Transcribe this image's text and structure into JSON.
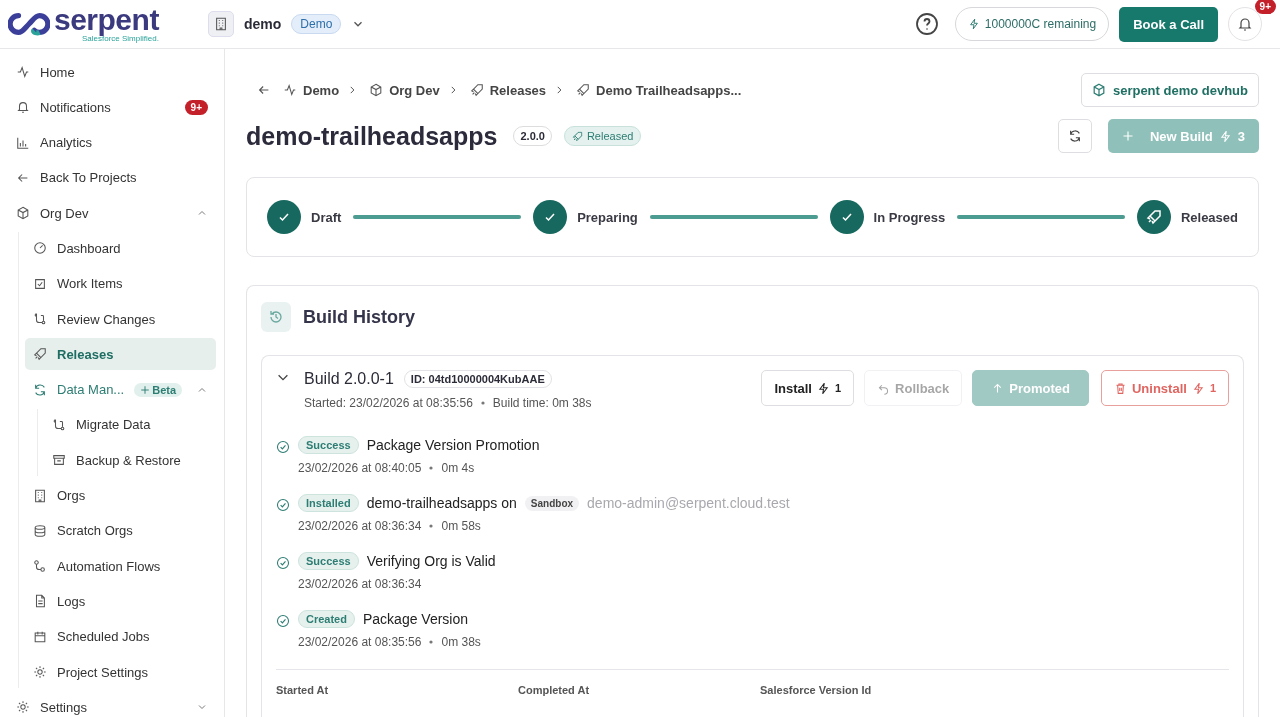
{
  "header": {
    "brand": "serpent",
    "tagline": "Salesforce Simplified.",
    "org": {
      "name": "demo",
      "badge": "Demo"
    },
    "credits": "1000000C remaining",
    "cta": "Book a Call",
    "notification_badge": "9+"
  },
  "sidebar": {
    "items": [
      {
        "label": "Home",
        "selected": false
      },
      {
        "label": "Notifications",
        "badge": "9+",
        "selected": false
      },
      {
        "label": "Analytics",
        "selected": false
      },
      {
        "label": "Back To Projects",
        "selected": false
      },
      {
        "label": "Org Dev",
        "selected": false,
        "expanded": true,
        "children": [
          {
            "label": "Dashboard",
            "selected": false
          },
          {
            "label": "Work Items",
            "selected": false
          },
          {
            "label": "Review Changes",
            "selected": false
          },
          {
            "label": "Releases",
            "selected": true
          },
          {
            "label": "Data Man...",
            "tag": "Beta",
            "selected": false,
            "expanded": true,
            "children": [
              {
                "label": "Migrate Data",
                "selected": false
              },
              {
                "label": "Backup & Restore",
                "selected": false
              }
            ]
          },
          {
            "label": "Orgs",
            "selected": false
          },
          {
            "label": "Scratch Orgs",
            "selected": false
          },
          {
            "label": "Automation Flows",
            "selected": false
          },
          {
            "label": "Logs",
            "selected": false
          },
          {
            "label": "Scheduled Jobs",
            "selected": false
          },
          {
            "label": "Project Settings",
            "selected": false
          }
        ]
      },
      {
        "label": "Settings",
        "selected": false,
        "expanded": false
      }
    ]
  },
  "breadcrumbs": [
    "Demo",
    "Org Dev",
    "Releases",
    "Demo Trailheadsapps..."
  ],
  "devhub": "serpent demo devhub",
  "page": {
    "title": "demo-trailheadsapps",
    "version": "2.0.0",
    "status": "Released",
    "new_build": {
      "label": "New Build",
      "count": "3",
      "disabled": true
    }
  },
  "steps": [
    {
      "label": "Draft",
      "kind": "done"
    },
    {
      "label": "Preparing",
      "kind": "done"
    },
    {
      "label": "In Progress",
      "kind": "done"
    },
    {
      "label": "Released",
      "kind": "released"
    }
  ],
  "connectors": [
    {
      "level": 1
    },
    {
      "level": 1
    },
    {
      "level": 1
    }
  ],
  "history": {
    "title": "Build History",
    "build": {
      "title": "Build 2.0.0-1",
      "id": "ID: 04td10000004KubAAE",
      "started": "Started: 23/02/2026 at 08:35:56",
      "build_time": "Build time: 0m 38s",
      "expanded": true,
      "actions": [
        {
          "label": "Install",
          "count": "1",
          "kind": "default",
          "disabled": false
        },
        {
          "label": "Rollback",
          "kind": "rollback",
          "disabled": true
        },
        {
          "label": "Promoted",
          "kind": "promoted",
          "disabled": true
        },
        {
          "label": "Uninstall",
          "count": "1",
          "kind": "danger",
          "disabled": false
        }
      ],
      "events": [
        {
          "badge": "Success",
          "title": "Package Version Promotion",
          "date": "23/02/2026 at 08:40:05",
          "duration": "0m 4s"
        },
        {
          "badge": "Installed",
          "title": "demo-trailheadsapps on",
          "org_type": "Sandbox",
          "user": "demo-admin@serpent.cloud.test",
          "date": "23/02/2026 at 08:36:34",
          "duration": "0m 58s"
        },
        {
          "badge": "Success",
          "title": "Verifying Org is Valid",
          "date": "23/02/2026 at 08:36:34"
        },
        {
          "badge": "Created",
          "title": "Package Version",
          "date": "23/02/2026 at 08:35:56",
          "duration": "0m 38s"
        }
      ],
      "columns": [
        "Started At",
        "Completed At",
        "Salesforce Version Id"
      ]
    }
  }
}
